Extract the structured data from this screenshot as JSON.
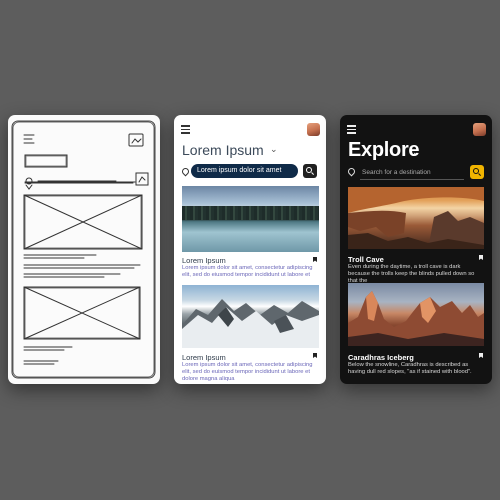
{
  "light": {
    "title": "Lorem Ipsum",
    "chevron": "⌄",
    "search_text": "Lorem ipsum dolor sit amet",
    "cards": [
      {
        "title": "Lorem Ipsum",
        "text": "Lorem ipsum dolor sit amet, consectetur adipiscing elit, sed do eiusmod tempor incididunt ut labore et"
      },
      {
        "title": "Lorem Ipsum",
        "text": "Lorem ipsum dolor sit amet, consectetur adipiscing elit, sed do euismod tempor incididunt ut labore et dolore magna aliqua"
      }
    ]
  },
  "dark": {
    "title": "Explore",
    "chevron": "⌄",
    "search_placeholder": "Search for a destination",
    "accent": "#f0b400",
    "cards": [
      {
        "title": "Troll Cave",
        "text": "Even during the daytime, a troll cave is dark because the trolls keep the blinds pulled down so that the"
      },
      {
        "title": "Caradhras Iceberg",
        "text": "Below the snowline, Caradhras is described as having dull red slopes, \"as if stained with blood\"."
      }
    ]
  }
}
